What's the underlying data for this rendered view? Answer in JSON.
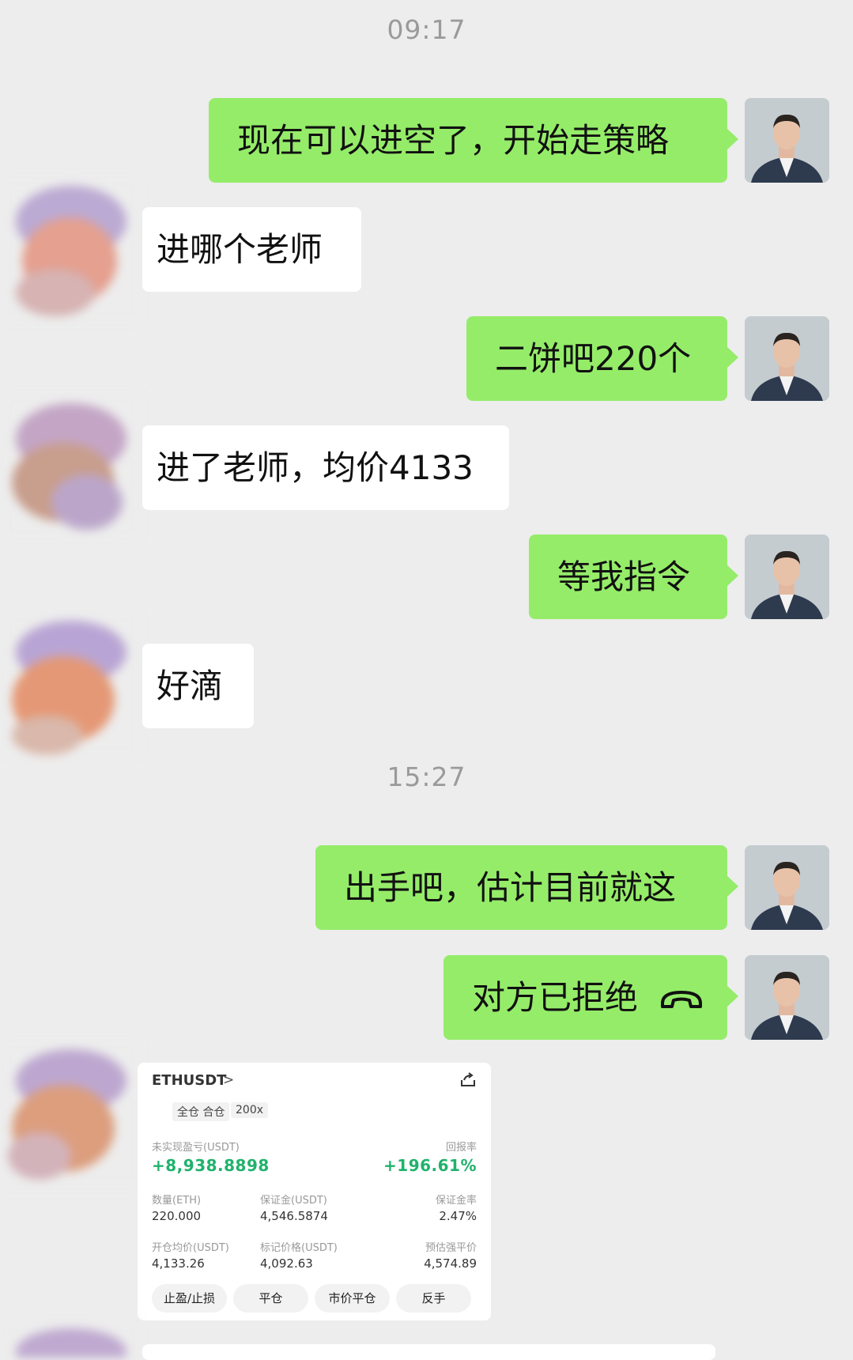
{
  "timestamps": [
    "09:17",
    "15:27"
  ],
  "messages": [
    {
      "from": "me",
      "text": "现在可以进空了，开始走策略"
    },
    {
      "from": "them",
      "text": "进哪个老师"
    },
    {
      "from": "me",
      "text": "二饼吧220个"
    },
    {
      "from": "them",
      "text": "进了老师，均价4133"
    },
    {
      "from": "me",
      "text": "等我指令"
    },
    {
      "from": "them",
      "text": "好滴"
    },
    {
      "from": "me",
      "text": "出手吧，估计目前就这"
    },
    {
      "from": "me",
      "text": "对方已拒绝",
      "icon": "hangup-phone-icon"
    }
  ],
  "card": {
    "symbol": "ETHUSDT",
    "symbol_chevron": ">",
    "tags": [
      "全仓 合仓",
      "200x"
    ],
    "pnl_label": "未实现盈亏(USDT)",
    "pnl_value": "+8,938.8898",
    "roe_label": "回报率",
    "roe_value": "+196.61%",
    "fields": [
      {
        "label": "数量(ETH)",
        "value": "220.000"
      },
      {
        "label": "保证金(USDT)",
        "value": "4,546.5874"
      },
      {
        "label": "保证金率",
        "value": "2.47%"
      },
      {
        "label": "开仓均价(USDT)",
        "value": "4,133.26"
      },
      {
        "label": "标记价格(USDT)",
        "value": "4,092.63"
      },
      {
        "label": "预估强平价",
        "value": "4,574.89"
      }
    ],
    "buttons": [
      "止盈/止损",
      "平仓",
      "市价平仓",
      "反手"
    ]
  },
  "colors": {
    "background": "#ededed",
    "my_bubble": "#95ec69",
    "their_bubble": "#ffffff",
    "profit_green": "#20b26c"
  }
}
